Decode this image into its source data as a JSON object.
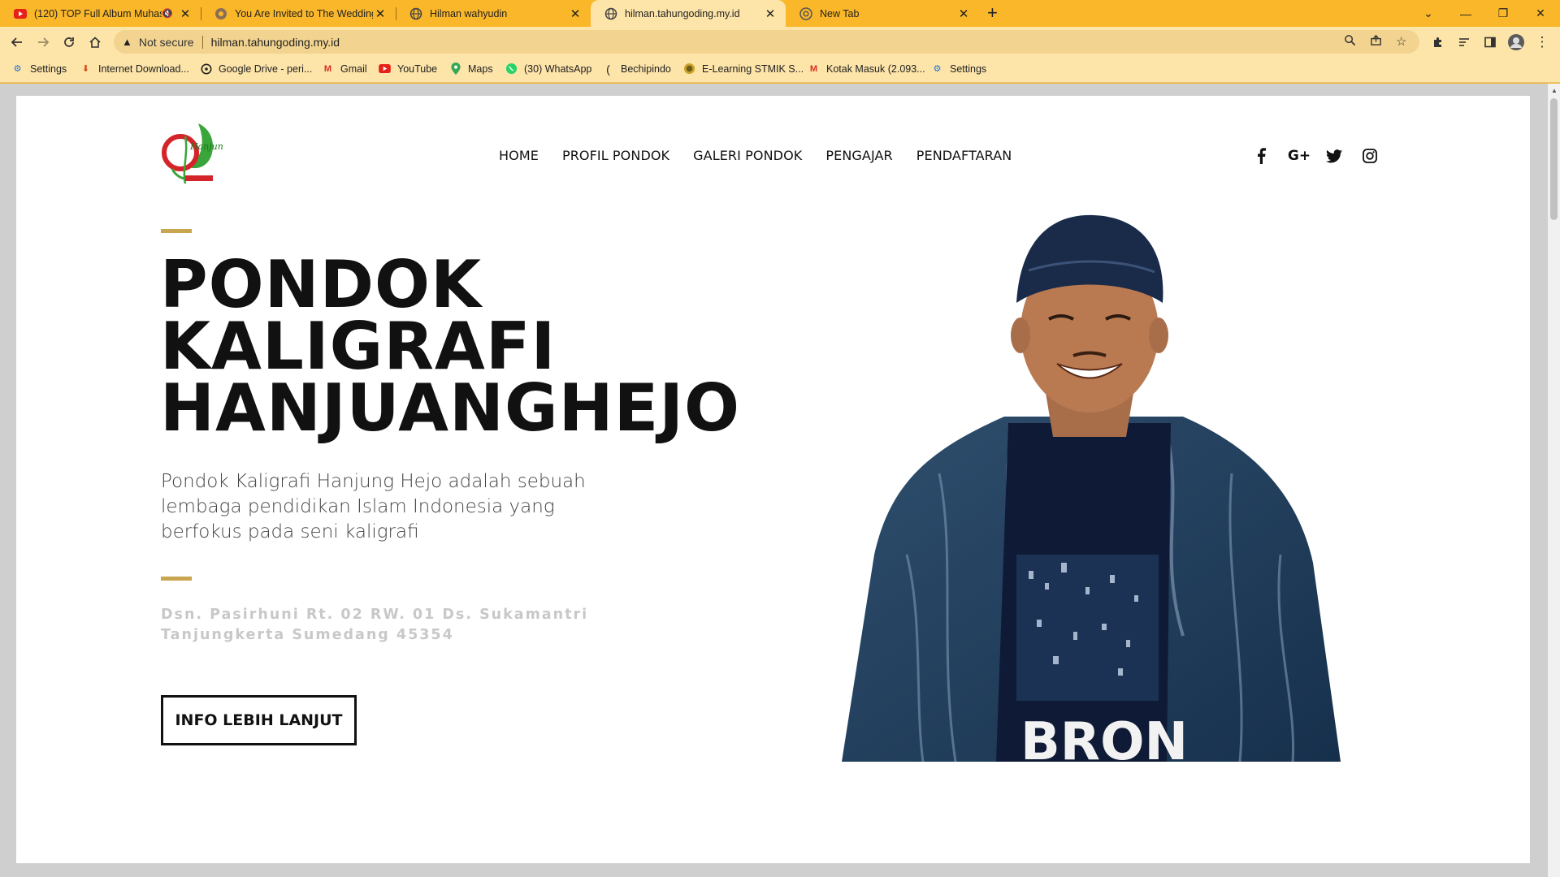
{
  "browser": {
    "tabs": [
      {
        "title": "(120) TOP Full Album Muhas",
        "icon": "youtube-icon",
        "muted": true
      },
      {
        "title": "You Are Invited to The Wedding",
        "icon": "web-icon"
      },
      {
        "title": "Hilman wahyudin",
        "icon": "globe-icon"
      },
      {
        "title": "hilman.tahungoding.my.id",
        "icon": "globe-icon",
        "active": true
      },
      {
        "title": "New Tab",
        "icon": "chrome-icon"
      }
    ],
    "security_label": "Not secure",
    "url": "hilman.tahungoding.my.id",
    "bookmarks": [
      {
        "label": "Settings",
        "icon": "gear-icon"
      },
      {
        "label": "Internet Download...",
        "icon": "idm-icon"
      },
      {
        "label": "Google Drive - peri...",
        "icon": "drive-icon"
      },
      {
        "label": "Gmail",
        "icon": "gmail-icon"
      },
      {
        "label": "YouTube",
        "icon": "youtube-icon"
      },
      {
        "label": "Maps",
        "icon": "maps-icon"
      },
      {
        "label": "(30) WhatsApp",
        "icon": "whatsapp-icon"
      },
      {
        "label": "Bechipindo",
        "icon": "bechipindo-icon"
      },
      {
        "label": "E-Learning STMIK S...",
        "icon": "elearning-icon"
      },
      {
        "label": "Kotak Masuk (2.093...",
        "icon": "gmail-icon"
      },
      {
        "label": "Settings",
        "icon": "gear-icon"
      }
    ]
  },
  "site": {
    "logo_text": "Hanjung Hejo",
    "nav": [
      "HOME",
      "PROFIL PONDOK",
      "GALERI PONDOK",
      "PENGAJAR",
      "PENDAFTARAN"
    ],
    "social_icons": [
      "facebook-icon",
      "google-plus-icon",
      "twitter-icon",
      "instagram-icon"
    ],
    "hero": {
      "title_lines": [
        "PONDOK",
        "KALIGRAFI",
        "HANJUANGHEJO"
      ],
      "description": "Pondok Kaligrafi Hanjung Hejo adalah sebuah lembaga pendidikan Islam Indonesia yang berfokus pada seni kaligrafi",
      "address_line1": "Dsn. Pasirhuni Rt. 02 RW. 01 Ds. Sukamantri",
      "address_line2": "Tanjungkerta Sumedang 45354",
      "cta_label": "INFO LEBIH LANJUT",
      "photo_shirt_text": "BRON"
    },
    "accent_color": "#c9a54f"
  }
}
